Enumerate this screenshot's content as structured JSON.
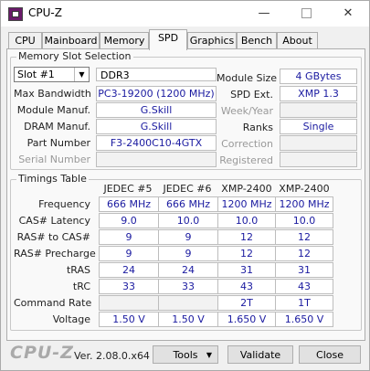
{
  "window": {
    "title": "CPU-Z",
    "min_glyph": "—",
    "close_glyph": "✕"
  },
  "tabs": [
    "CPU",
    "Mainboard",
    "Memory",
    "SPD",
    "Graphics",
    "Bench",
    "About"
  ],
  "active_tab": "SPD",
  "slot_section": {
    "title": "Memory Slot Selection",
    "slot_selected": "Slot #1",
    "memory_type": "DDR3",
    "labels": {
      "max_bandwidth": "Max Bandwidth",
      "module_manuf": "Module Manuf.",
      "dram_manuf": "DRAM Manuf.",
      "part_number": "Part Number",
      "serial_number": "Serial Number",
      "module_size": "Module Size",
      "spd_ext": "SPD Ext.",
      "week_year": "Week/Year",
      "ranks": "Ranks",
      "correction": "Correction",
      "registered": "Registered"
    },
    "values": {
      "max_bandwidth": "PC3-19200 (1200 MHz)",
      "module_manuf": "G.Skill",
      "dram_manuf": "G.Skill",
      "part_number": "F3-2400C10-4GTX",
      "serial_number": "",
      "module_size": "4 GBytes",
      "spd_ext": "XMP 1.3",
      "week_year": "",
      "ranks": "Single",
      "correction": "",
      "registered": ""
    }
  },
  "timings": {
    "title": "Timings Table",
    "columns": [
      "JEDEC #5",
      "JEDEC #6",
      "XMP-2400",
      "XMP-2400"
    ],
    "rows": [
      {
        "label": "Frequency",
        "values": [
          "666 MHz",
          "666 MHz",
          "1200 MHz",
          "1200 MHz"
        ]
      },
      {
        "label": "CAS# Latency",
        "values": [
          "9.0",
          "10.0",
          "10.0",
          "10.0"
        ]
      },
      {
        "label": "RAS# to CAS#",
        "values": [
          "9",
          "9",
          "12",
          "12"
        ]
      },
      {
        "label": "RAS# Precharge",
        "values": [
          "9",
          "9",
          "12",
          "12"
        ]
      },
      {
        "label": "tRAS",
        "values": [
          "24",
          "24",
          "31",
          "31"
        ]
      },
      {
        "label": "tRC",
        "values": [
          "33",
          "33",
          "43",
          "43"
        ]
      },
      {
        "label": "Command Rate",
        "values": [
          "",
          "",
          "2T",
          "1T"
        ]
      },
      {
        "label": "Voltage",
        "values": [
          "1.50 V",
          "1.50 V",
          "1.650 V",
          "1.650 V"
        ]
      }
    ]
  },
  "footer": {
    "logo": "CPU-Z",
    "version": "Ver. 2.08.0.x64",
    "tools_label": "Tools",
    "validate_label": "Validate",
    "close_label": "Close"
  }
}
